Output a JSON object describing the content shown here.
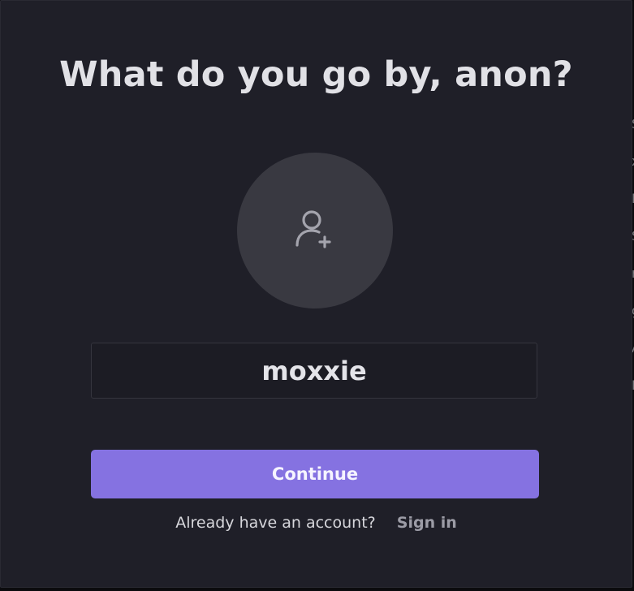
{
  "modal": {
    "title": "What do you go by, anon?",
    "avatar_icon": "user-plus-icon",
    "name_input": {
      "value": "moxxie"
    },
    "continue_label": "Continue",
    "signin_prompt": "Already have an account?",
    "signin_link": "Sign in"
  },
  "colors": {
    "modal_background": "#1f1f28",
    "avatar_background": "#393941",
    "accent": "#8572e1"
  }
}
